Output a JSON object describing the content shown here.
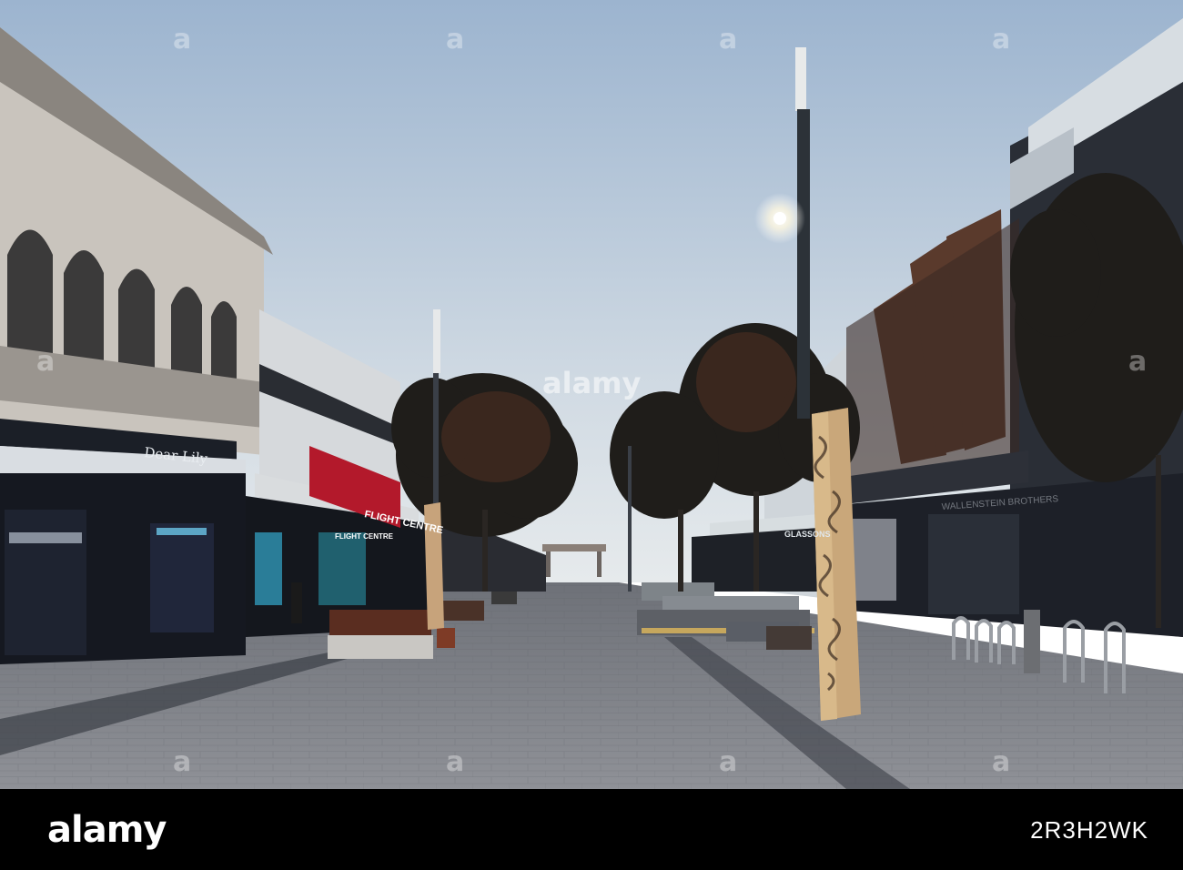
{
  "photo": {
    "description_free": true,
    "signs": {
      "dear_lily": "Dear Lily",
      "flight_centre": "FLIGHT CENTRE",
      "flight_centre_top": "FLIGHT CENTRE",
      "glassons": "GLASSONS",
      "brothers": "WALLENSTEIN BROTHERS"
    }
  },
  "watermark": {
    "center": "alamy",
    "tile": "a"
  },
  "footer": {
    "brand": "alamy",
    "image_id": "2R3H2WK"
  },
  "colors": {
    "sky_top": "#9fb6cf",
    "sky_bottom": "#d8e0e6",
    "pavement": "#7b7e84",
    "footer": "#000000"
  }
}
